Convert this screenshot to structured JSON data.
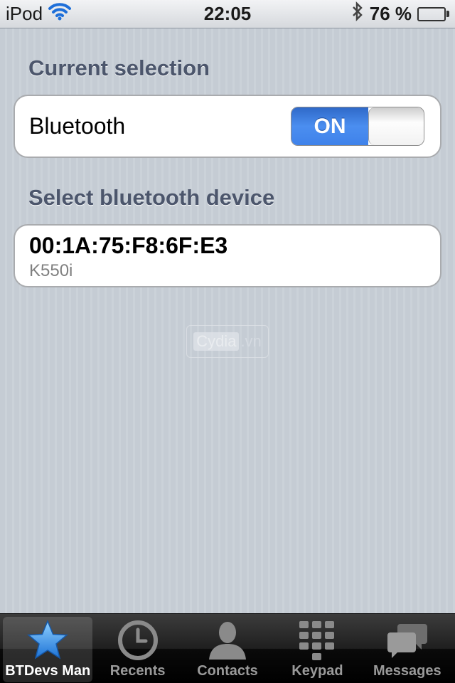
{
  "status_bar": {
    "carrier": "iPod",
    "time": "22:05",
    "battery_percent": "76 %",
    "battery_level": 0.76
  },
  "sections": {
    "current_selection_header": "Current selection",
    "select_device_header": "Select bluetooth device"
  },
  "bluetooth": {
    "label": "Bluetooth",
    "toggle_state": "ON"
  },
  "device": {
    "address": "00:1A:75:F8:6F:E3",
    "name": "K550i"
  },
  "watermark": {
    "brand": "Cydia",
    "suffix": ".vn"
  },
  "tab_bar": {
    "tabs": [
      {
        "label": "BTDevs Man",
        "icon": "star-icon"
      },
      {
        "label": "Recents",
        "icon": "clock-icon"
      },
      {
        "label": "Contacts",
        "icon": "person-icon"
      },
      {
        "label": "Keypad",
        "icon": "keypad-icon"
      },
      {
        "label": "Messages",
        "icon": "messages-icon"
      }
    ]
  },
  "colors": {
    "accent": "#3f82ea",
    "battery": "#4cc22a",
    "section_header": "#4c566c"
  }
}
